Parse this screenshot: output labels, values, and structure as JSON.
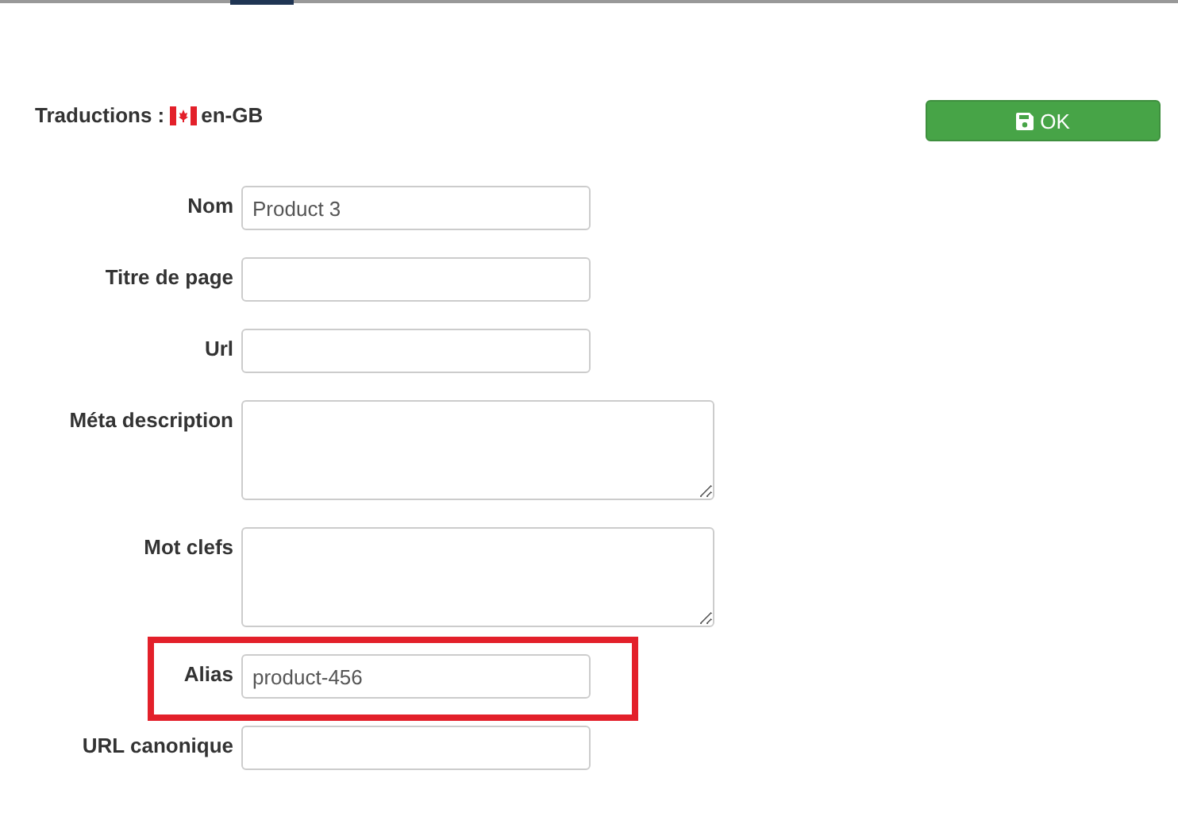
{
  "heading": {
    "label": "Traductions :",
    "language": "en-GB"
  },
  "ok_button": {
    "label": "OK"
  },
  "fields": [
    {
      "label": "Nom",
      "kind": "text",
      "value": "Product 3",
      "highlighted": false
    },
    {
      "label": "Titre de page",
      "kind": "text",
      "highlighted": false
    },
    {
      "label": "Url",
      "kind": "text",
      "highlighted": false
    },
    {
      "label": "Méta description",
      "kind": "textarea",
      "highlighted": false
    },
    {
      "label": "Mot clefs",
      "kind": "textarea",
      "highlighted": false
    },
    {
      "label": "Alias",
      "kind": "text",
      "value": "product-456",
      "highlighted": true
    },
    {
      "label": "URL canonique",
      "kind": "text",
      "highlighted": false
    }
  ]
}
